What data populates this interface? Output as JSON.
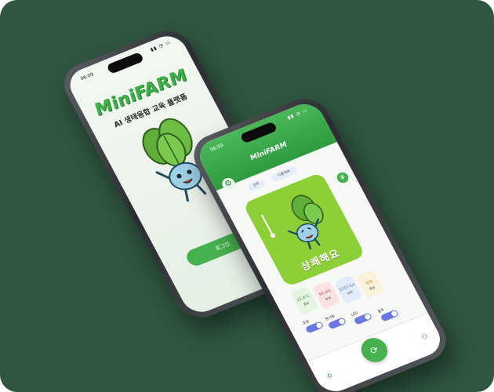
{
  "phones": {
    "left": {
      "status_time": "06:09",
      "logo": "MiniFARM",
      "subtitle": "AI 생태융합 교육 플랫폼",
      "login_button": "로그인"
    },
    "right": {
      "status_time": "06:09",
      "app_title": "MiniFARM",
      "chips": [
        "상추",
        "식물재배"
      ],
      "plant_status": "상쾌해요",
      "sensors": [
        {
          "value": "22.8°C",
          "label": "좋음"
        },
        {
          "value": "95.4%",
          "label": "높음"
        },
        {
          "value": "1231 lux",
          "label": "부족"
        },
        {
          "value": "양호",
          "label": "좋음"
        }
      ],
      "toggles": [
        "조명",
        "환기팬",
        "LED",
        "물주"
      ]
    }
  },
  "colors": {
    "background": "#2f5640",
    "brand_green": "#46b14f",
    "card_green": "#8dcf37"
  },
  "icons": [
    "gear-icon",
    "leaf-icon",
    "home-icon",
    "user-icon",
    "thermometer-icon"
  ]
}
